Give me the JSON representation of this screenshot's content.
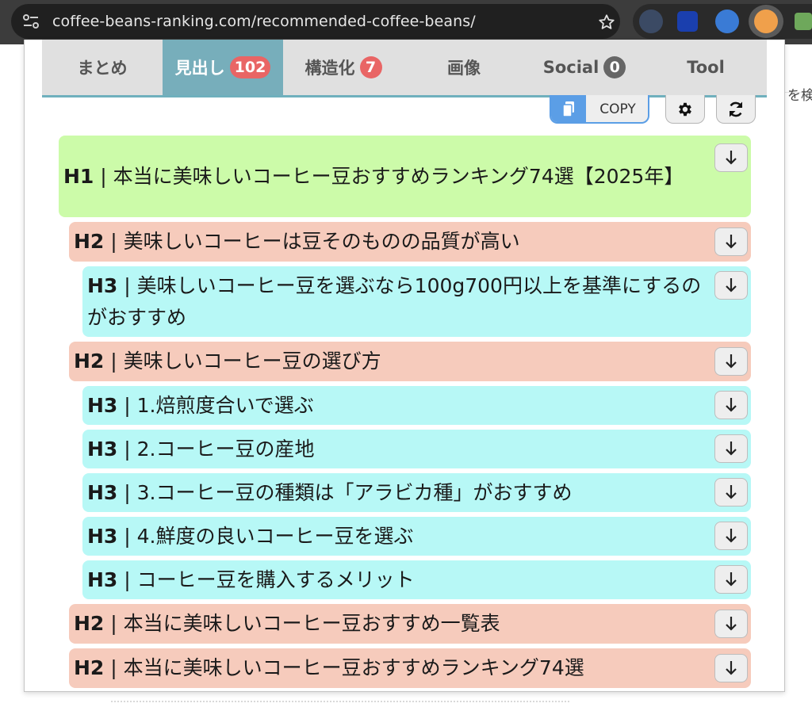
{
  "browser": {
    "url": "coffee-beans-ranking.com/recommended-coffee-beans/",
    "bg_search_text": "を検"
  },
  "tabs": [
    {
      "label": "まとめ",
      "badge": ""
    },
    {
      "label": "見出し",
      "badge": "102"
    },
    {
      "label": "構造化",
      "badge": "7"
    },
    {
      "label": "画像",
      "badge": ""
    },
    {
      "label": "Social",
      "badge": "0"
    },
    {
      "label": "Tool",
      "badge": ""
    }
  ],
  "toolbar": {
    "copy_label": "COPY"
  },
  "headings": [
    {
      "level": "H1",
      "text": "本当に美味しいコーヒー豆おすすめランキング74選【2025年】"
    },
    {
      "level": "H2",
      "text": "美味しいコーヒーは豆そのものの品質が高い"
    },
    {
      "level": "H3",
      "text": "美味しいコーヒー豆を選ぶなら100g700円以上を基準にするのがおすすめ"
    },
    {
      "level": "H2",
      "text": "美味しいコーヒー豆の選び方"
    },
    {
      "level": "H3",
      "text": "1.焙煎度合いで選ぶ"
    },
    {
      "level": "H3",
      "text": "2.コーヒー豆の産地"
    },
    {
      "level": "H3",
      "text": "3.コーヒー豆の種類は「アラビカ種」がおすすめ"
    },
    {
      "level": "H3",
      "text": "4.鮮度の良いコーヒー豆を選ぶ"
    },
    {
      "level": "H3",
      "text": "コーヒー豆を購入するメリット"
    },
    {
      "level": "H2",
      "text": "本当に美味しいコーヒー豆おすすめ一覧表"
    },
    {
      "level": "H2",
      "text": "本当に美味しいコーヒー豆おすすめランキング74選"
    }
  ],
  "colors": {
    "h1_bg": "#ccfba9",
    "h2_bg": "#f6cbbc",
    "h3_bg": "#b7f8f6",
    "active_tab": "#77aebb",
    "badge_red": "#e96565"
  }
}
